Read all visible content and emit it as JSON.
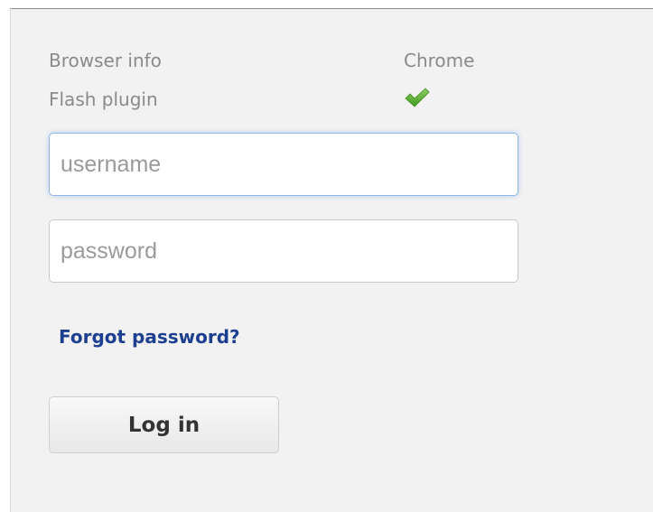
{
  "browser_info": {
    "label": "Browser info",
    "value": "Chrome"
  },
  "flash_plugin": {
    "label": "Flash plugin",
    "status_icon": "check-icon",
    "status_color": "#5cb030"
  },
  "login_form": {
    "username_placeholder": "username",
    "username_value": "",
    "password_placeholder": "password",
    "password_value": "",
    "forgot_label": "Forgot password?",
    "login_label": "Log in"
  },
  "colors": {
    "link": "#1d3f8f",
    "muted_text": "#8a8a8a",
    "focus_border": "#8fb8e8",
    "panel_bg": "#f2f2f2"
  }
}
